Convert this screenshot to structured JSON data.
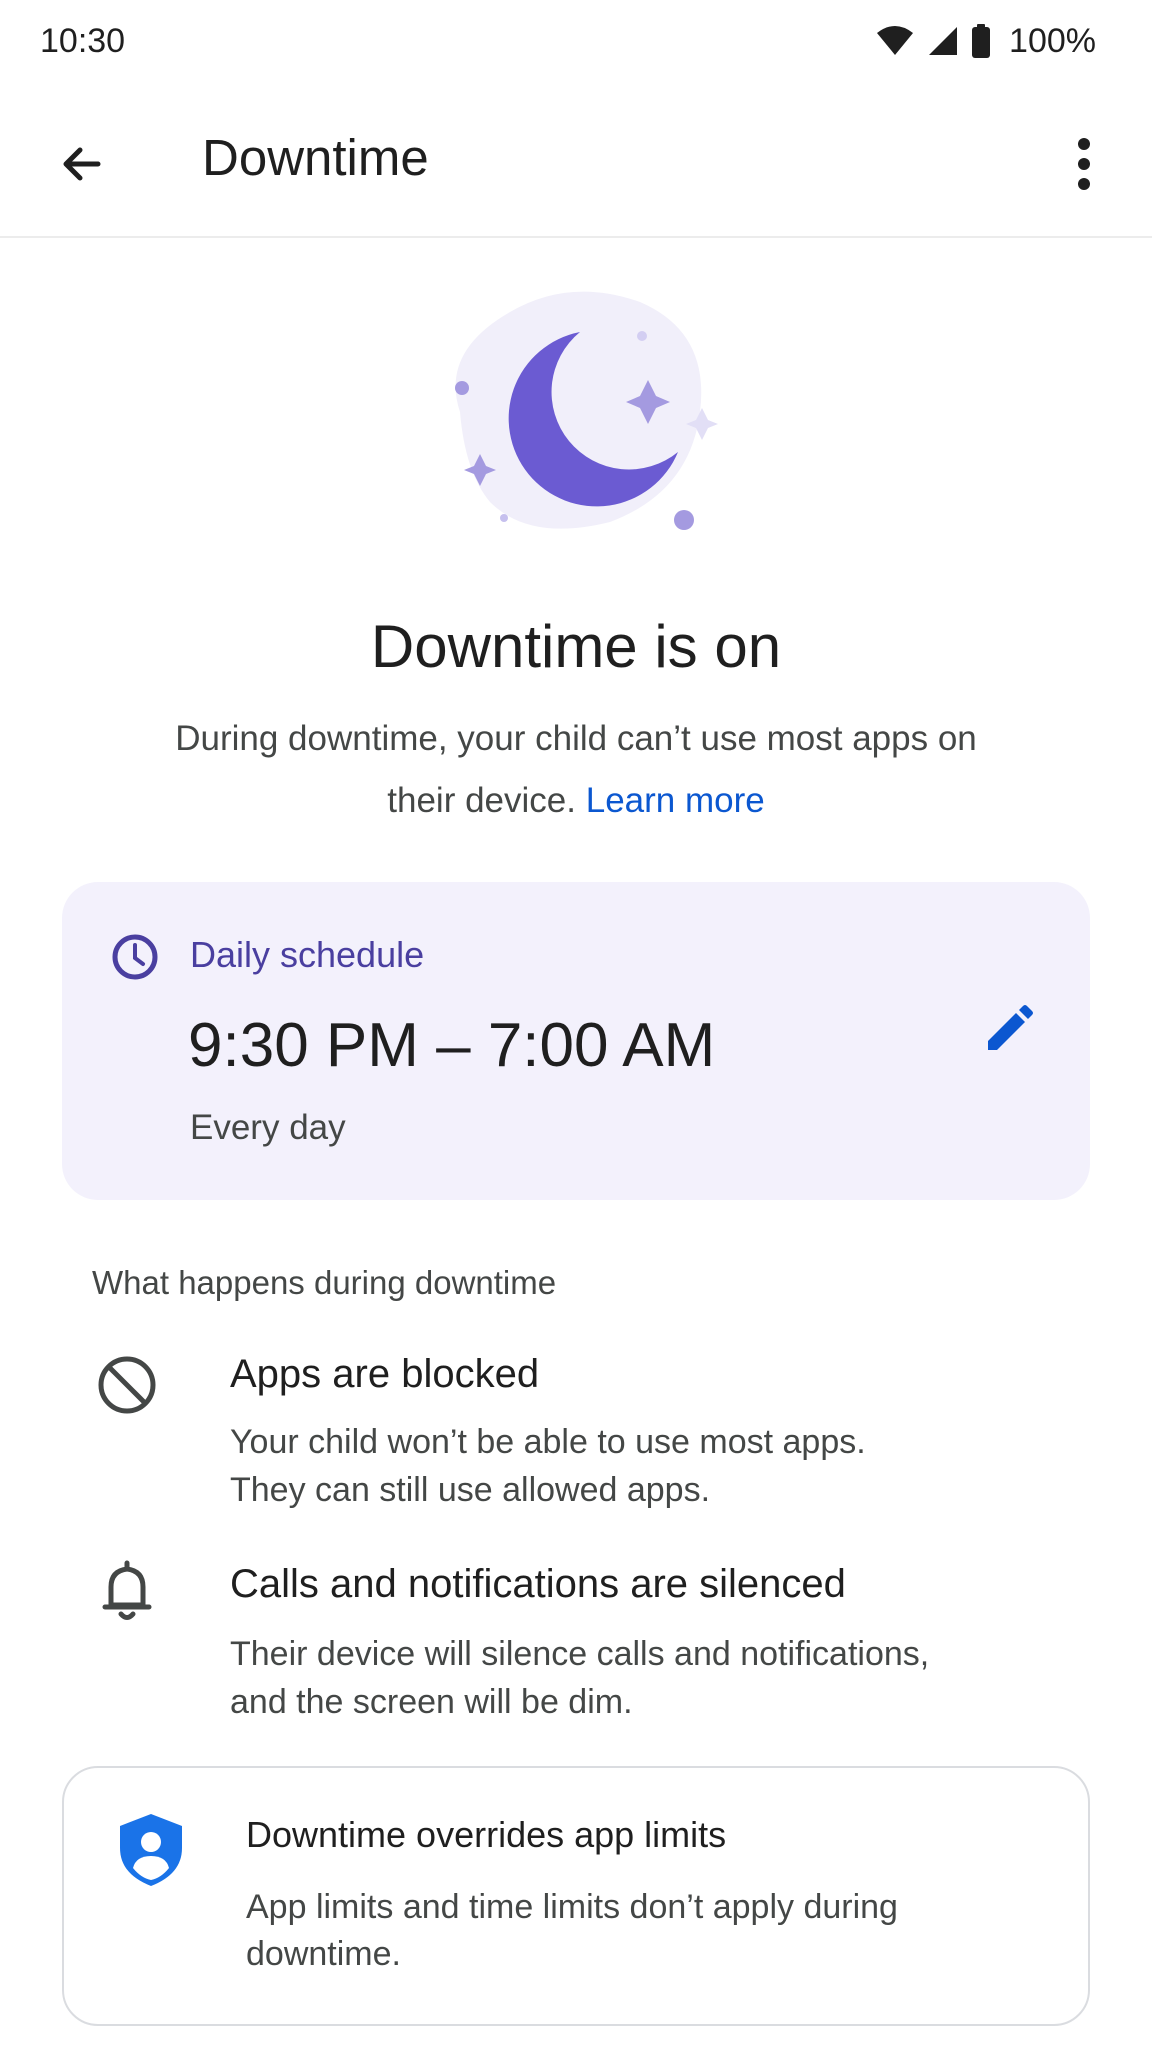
{
  "status_bar": {
    "time": "10:30",
    "battery": "100%",
    "icons": [
      "wifi-icon",
      "cell-signal-icon",
      "battery-icon"
    ]
  },
  "app_bar": {
    "title": "Downtime",
    "back_icon": "arrow-back-icon",
    "menu_icon": "more-vert-icon"
  },
  "hero": {
    "icon": "moon-illustration",
    "headline": "Downtime is on",
    "description": "During downtime, your child can’t use most apps on their device.",
    "learn_more": "Learn more"
  },
  "schedule": {
    "label": "Daily schedule",
    "time_range": "9:30 PM – 7:00 AM",
    "repeat": "Every day",
    "icon": "clock-icon",
    "edit_icon": "edit-icon"
  },
  "section": {
    "header": "What happens during downtime",
    "items": [
      {
        "icon": "block-icon",
        "title": "Apps are blocked",
        "body_line1": "Your child won’t be able to use most apps.",
        "body_line2": "They can still use allowed apps."
      },
      {
        "icon": "bell-icon",
        "title": "Calls and notifications are silenced",
        "body_line1": "Their device will silence calls and notifications,",
        "body_line2": "and the screen will be dim."
      }
    ]
  },
  "override_card": {
    "icon": "shield-person-icon",
    "title": "Downtime overrides app limits",
    "body_line1": "App limits and time limits don’t apply during",
    "body_line2": "downtime."
  },
  "colors": {
    "accent": "#6a5acd",
    "link": "#0b57d0",
    "card_bg": "#f3f1fc",
    "shield": "#1a73e8"
  }
}
